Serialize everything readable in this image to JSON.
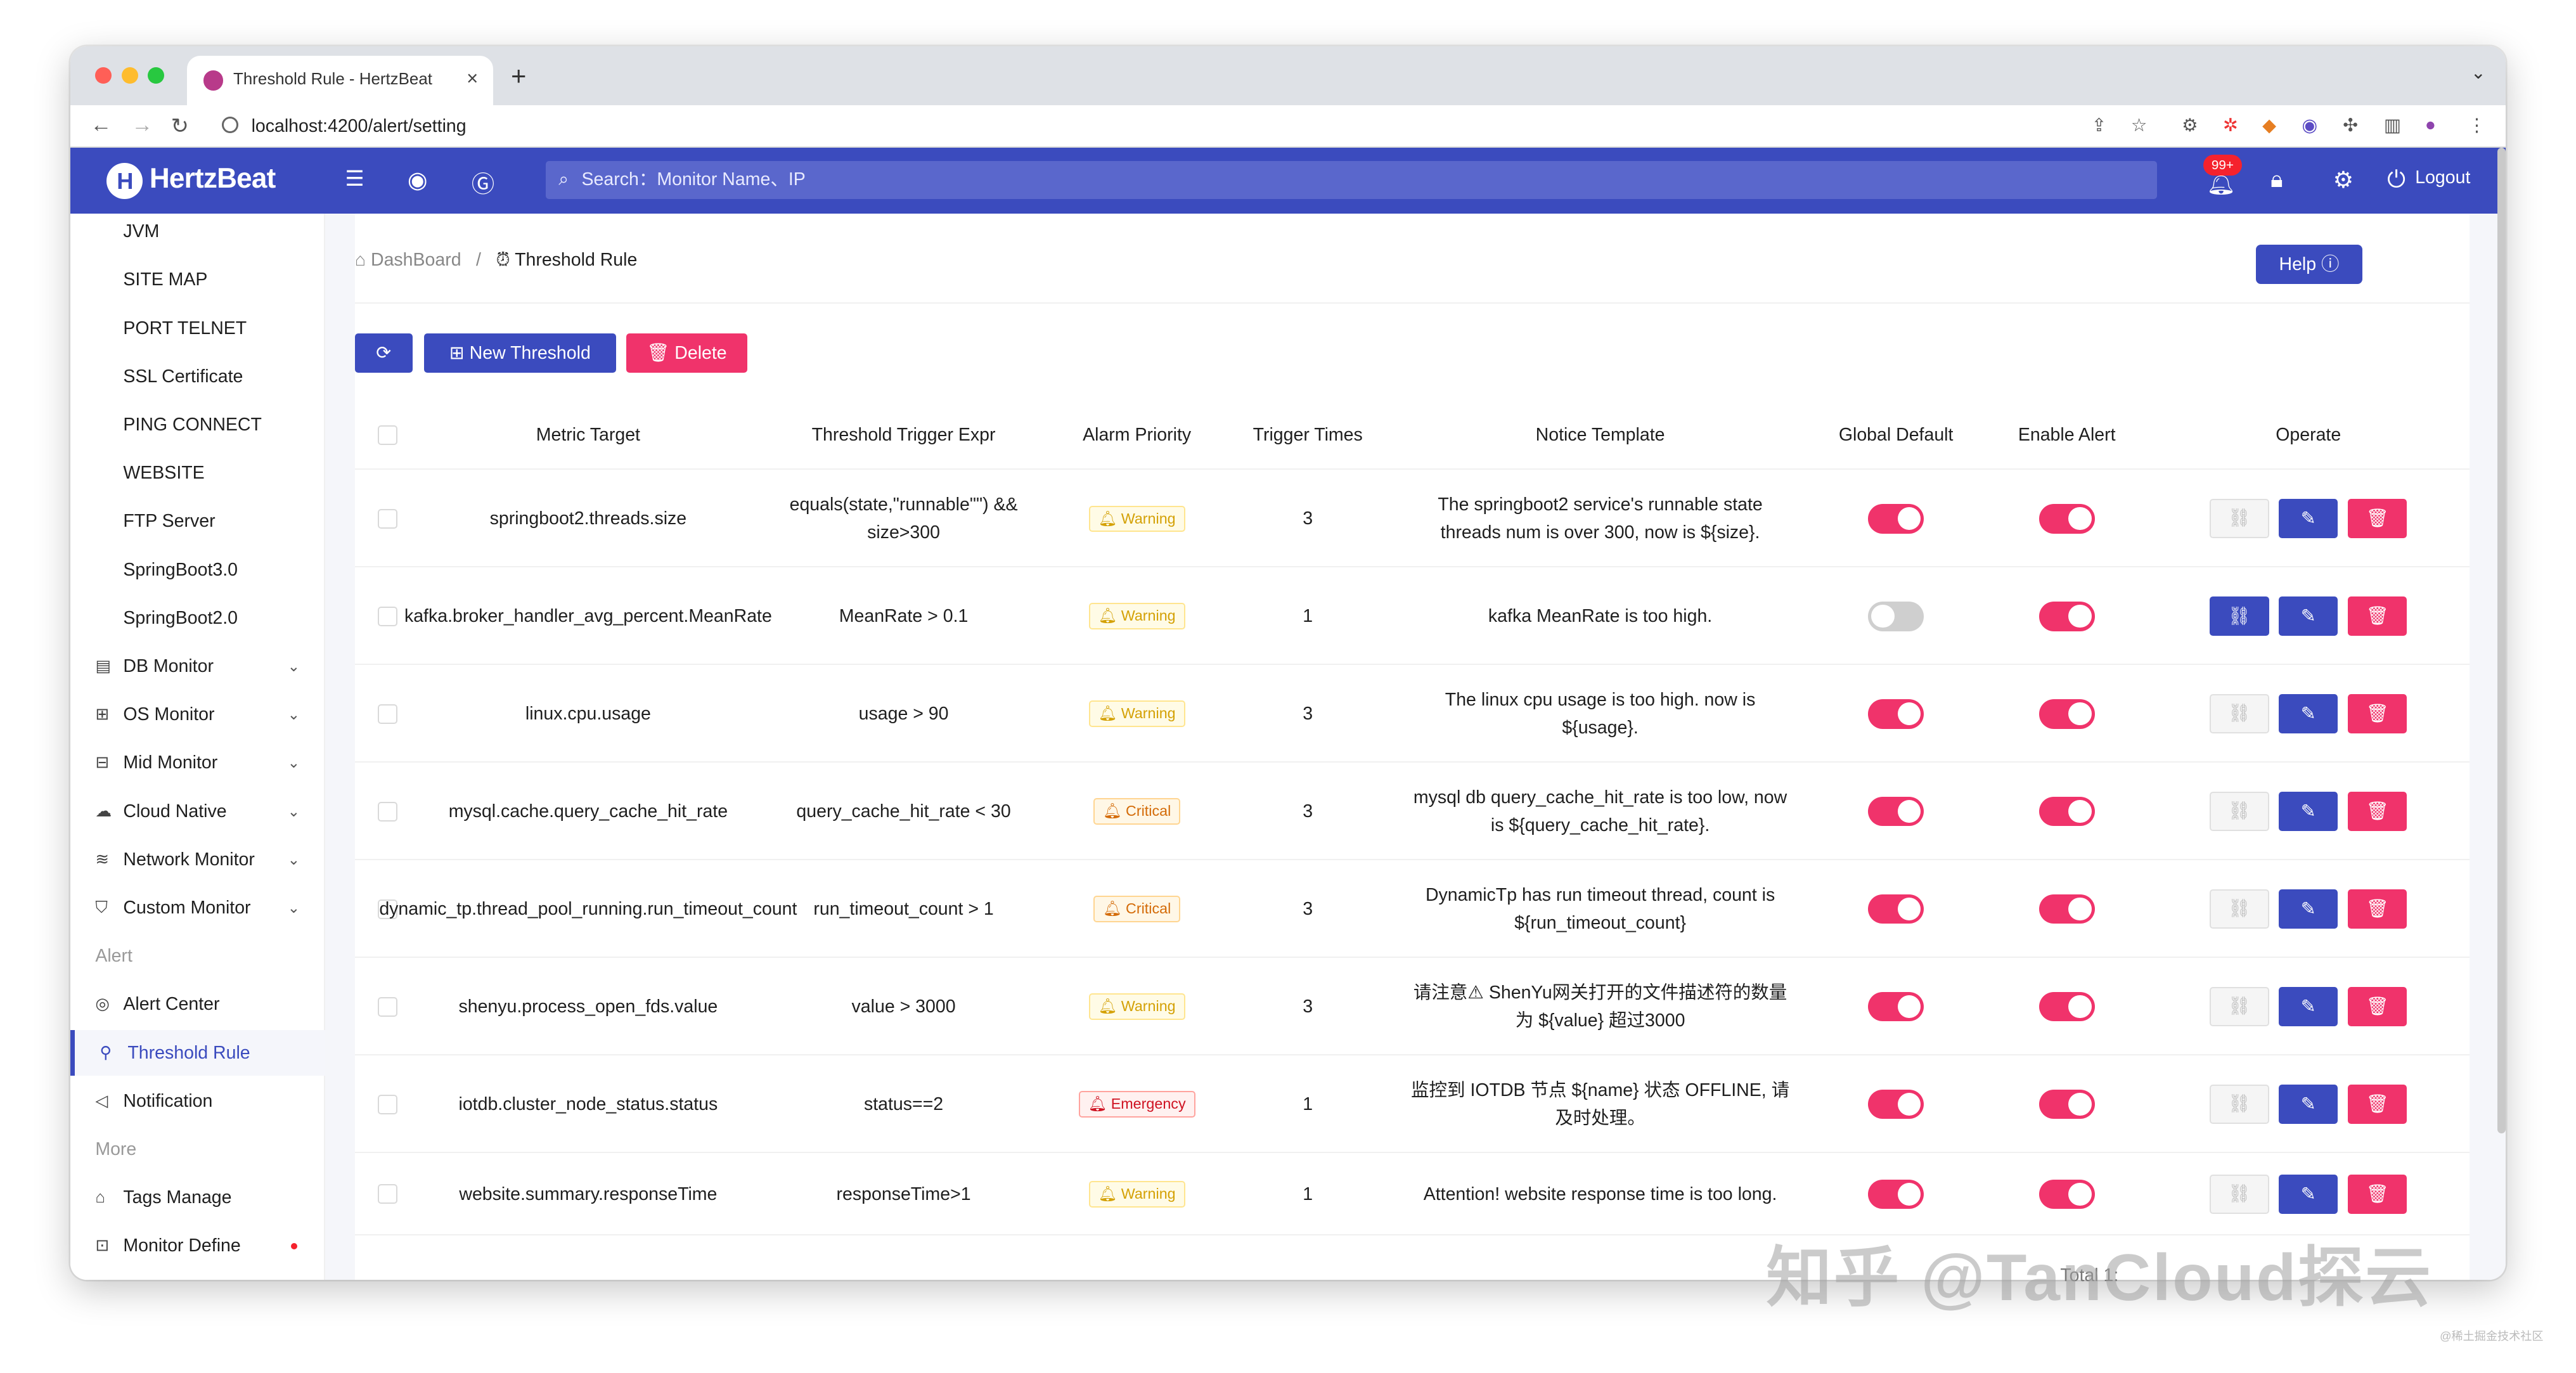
{
  "browser": {
    "tab_title": "Threshold Rule - HertzBeat",
    "url": "localhost:4200/alert/setting",
    "new_tab": "+",
    "close": "×",
    "menu": "⌄"
  },
  "header": {
    "logo": "HertzBeat",
    "search_placeholder": "Search：Monitor Name、IP",
    "badge": "99+",
    "logout": "Logout"
  },
  "sidebar": [
    {
      "label": "JVM",
      "type": "sub"
    },
    {
      "label": "SITE MAP",
      "type": "sub"
    },
    {
      "label": "PORT TELNET",
      "type": "sub"
    },
    {
      "label": "SSL Certificate",
      "type": "sub"
    },
    {
      "label": "PING CONNECT",
      "type": "sub"
    },
    {
      "label": "WEBSITE",
      "type": "sub"
    },
    {
      "label": "FTP Server",
      "type": "sub"
    },
    {
      "label": "SpringBoot3.0",
      "type": "sub"
    },
    {
      "label": "SpringBoot2.0",
      "type": "sub"
    },
    {
      "label": "DB Monitor",
      "type": "menu",
      "icon": "database-icon",
      "glyph": "▤"
    },
    {
      "label": "OS Monitor",
      "type": "menu",
      "icon": "os-icon",
      "glyph": "⊞"
    },
    {
      "label": "Mid Monitor",
      "type": "menu",
      "icon": "middleware-icon",
      "glyph": "⊟"
    },
    {
      "label": "Cloud Native",
      "type": "menu",
      "icon": "cloud-icon",
      "glyph": "☁"
    },
    {
      "label": "Network Monitor",
      "type": "menu",
      "icon": "wifi-icon",
      "glyph": "≋"
    },
    {
      "label": "Custom Monitor",
      "type": "menu",
      "icon": "custom-icon",
      "glyph": "⛉"
    },
    {
      "label": "Alert",
      "type": "group"
    },
    {
      "label": "Alert Center",
      "type": "item",
      "icon": "alert-center-icon",
      "glyph": "◎"
    },
    {
      "label": "Threshold Rule",
      "type": "item",
      "icon": "threshold-icon",
      "glyph": "⚲",
      "active": true
    },
    {
      "label": "Notification",
      "type": "item",
      "icon": "notification-icon",
      "glyph": "◁"
    },
    {
      "label": "More",
      "type": "group"
    },
    {
      "label": "Tags Manage",
      "type": "item",
      "icon": "tag-icon",
      "glyph": "⌂"
    },
    {
      "label": "Monitor Define",
      "type": "item",
      "icon": "define-icon",
      "glyph": "⊡",
      "dot": true
    }
  ],
  "breadcrumb": {
    "home": "DashBoard",
    "separator": "/",
    "current": "Threshold Rule"
  },
  "help_label": "Help",
  "toolbar": {
    "refresh": "⟳",
    "new": "New Threshold",
    "delete": "Delete"
  },
  "columns": [
    "Metric Target",
    "Threshold Trigger Expr",
    "Alarm Priority",
    "Trigger Times",
    "Notice Template",
    "Global Default",
    "Enable Alert",
    "Operate"
  ],
  "rows": [
    {
      "metric": "springboot2.threads.size",
      "expr": "equals(state,\"runnable\"\") && size>300",
      "priority": "Warning",
      "level": "warning",
      "times": "3",
      "template": "The springboot2 service's runnable state threads num is over 300, now is ${size}.",
      "global_default": true,
      "enable": true,
      "link_enabled": false
    },
    {
      "metric": "kafka.broker_handler_avg_percent.MeanRate",
      "expr": "MeanRate > 0.1",
      "priority": "Warning",
      "level": "warning",
      "times": "1",
      "template": "kafka MeanRate is too high.",
      "global_default": false,
      "enable": true,
      "link_enabled": true
    },
    {
      "metric": "linux.cpu.usage",
      "expr": "usage > 90",
      "priority": "Warning",
      "level": "warning",
      "times": "3",
      "template": "The linux cpu usage is too high. now is ${usage}.",
      "global_default": true,
      "enable": true,
      "link_enabled": false
    },
    {
      "metric": "mysql.cache.query_cache_hit_rate",
      "expr": "query_cache_hit_rate < 30",
      "priority": "Critical",
      "level": "critical",
      "times": "3",
      "template": "mysql db query_cache_hit_rate is too low, now is ${query_cache_hit_rate}.",
      "global_default": true,
      "enable": true,
      "link_enabled": false
    },
    {
      "metric": "dynamic_tp.thread_pool_running.run_timeout_count",
      "expr": "run_timeout_count > 1",
      "priority": "Critical",
      "level": "critical",
      "times": "3",
      "template": "DynamicTp has run timeout thread, count is ${run_timeout_count}",
      "global_default": true,
      "enable": true,
      "link_enabled": false
    },
    {
      "metric": "shenyu.process_open_fds.value",
      "expr": "value > 3000",
      "priority": "Warning",
      "level": "warning",
      "times": "3",
      "template": "请注意⚠ ShenYu网关打开的文件描述符的数量为 ${value} 超过3000",
      "global_default": true,
      "enable": true,
      "link_enabled": false
    },
    {
      "metric": "iotdb.cluster_node_status.status",
      "expr": "status==2",
      "priority": "Emergency",
      "level": "emergency",
      "times": "1",
      "template": "监控到 IOTDB 节点 ${name} 状态 OFFLINE, 请及时处理。",
      "global_default": true,
      "enable": true,
      "link_enabled": false
    },
    {
      "metric": "website.summary.responseTime",
      "expr": "responseTime>1",
      "priority": "Warning",
      "level": "warning",
      "times": "1",
      "template": "Attention! website response time is too long.",
      "global_default": true,
      "enable": true,
      "link_enabled": false
    }
  ],
  "pager": {
    "total_label": "Total 1:"
  },
  "watermark": "知乎 @TanCloud探云",
  "footer_small": "@稀土掘金技术社区"
}
